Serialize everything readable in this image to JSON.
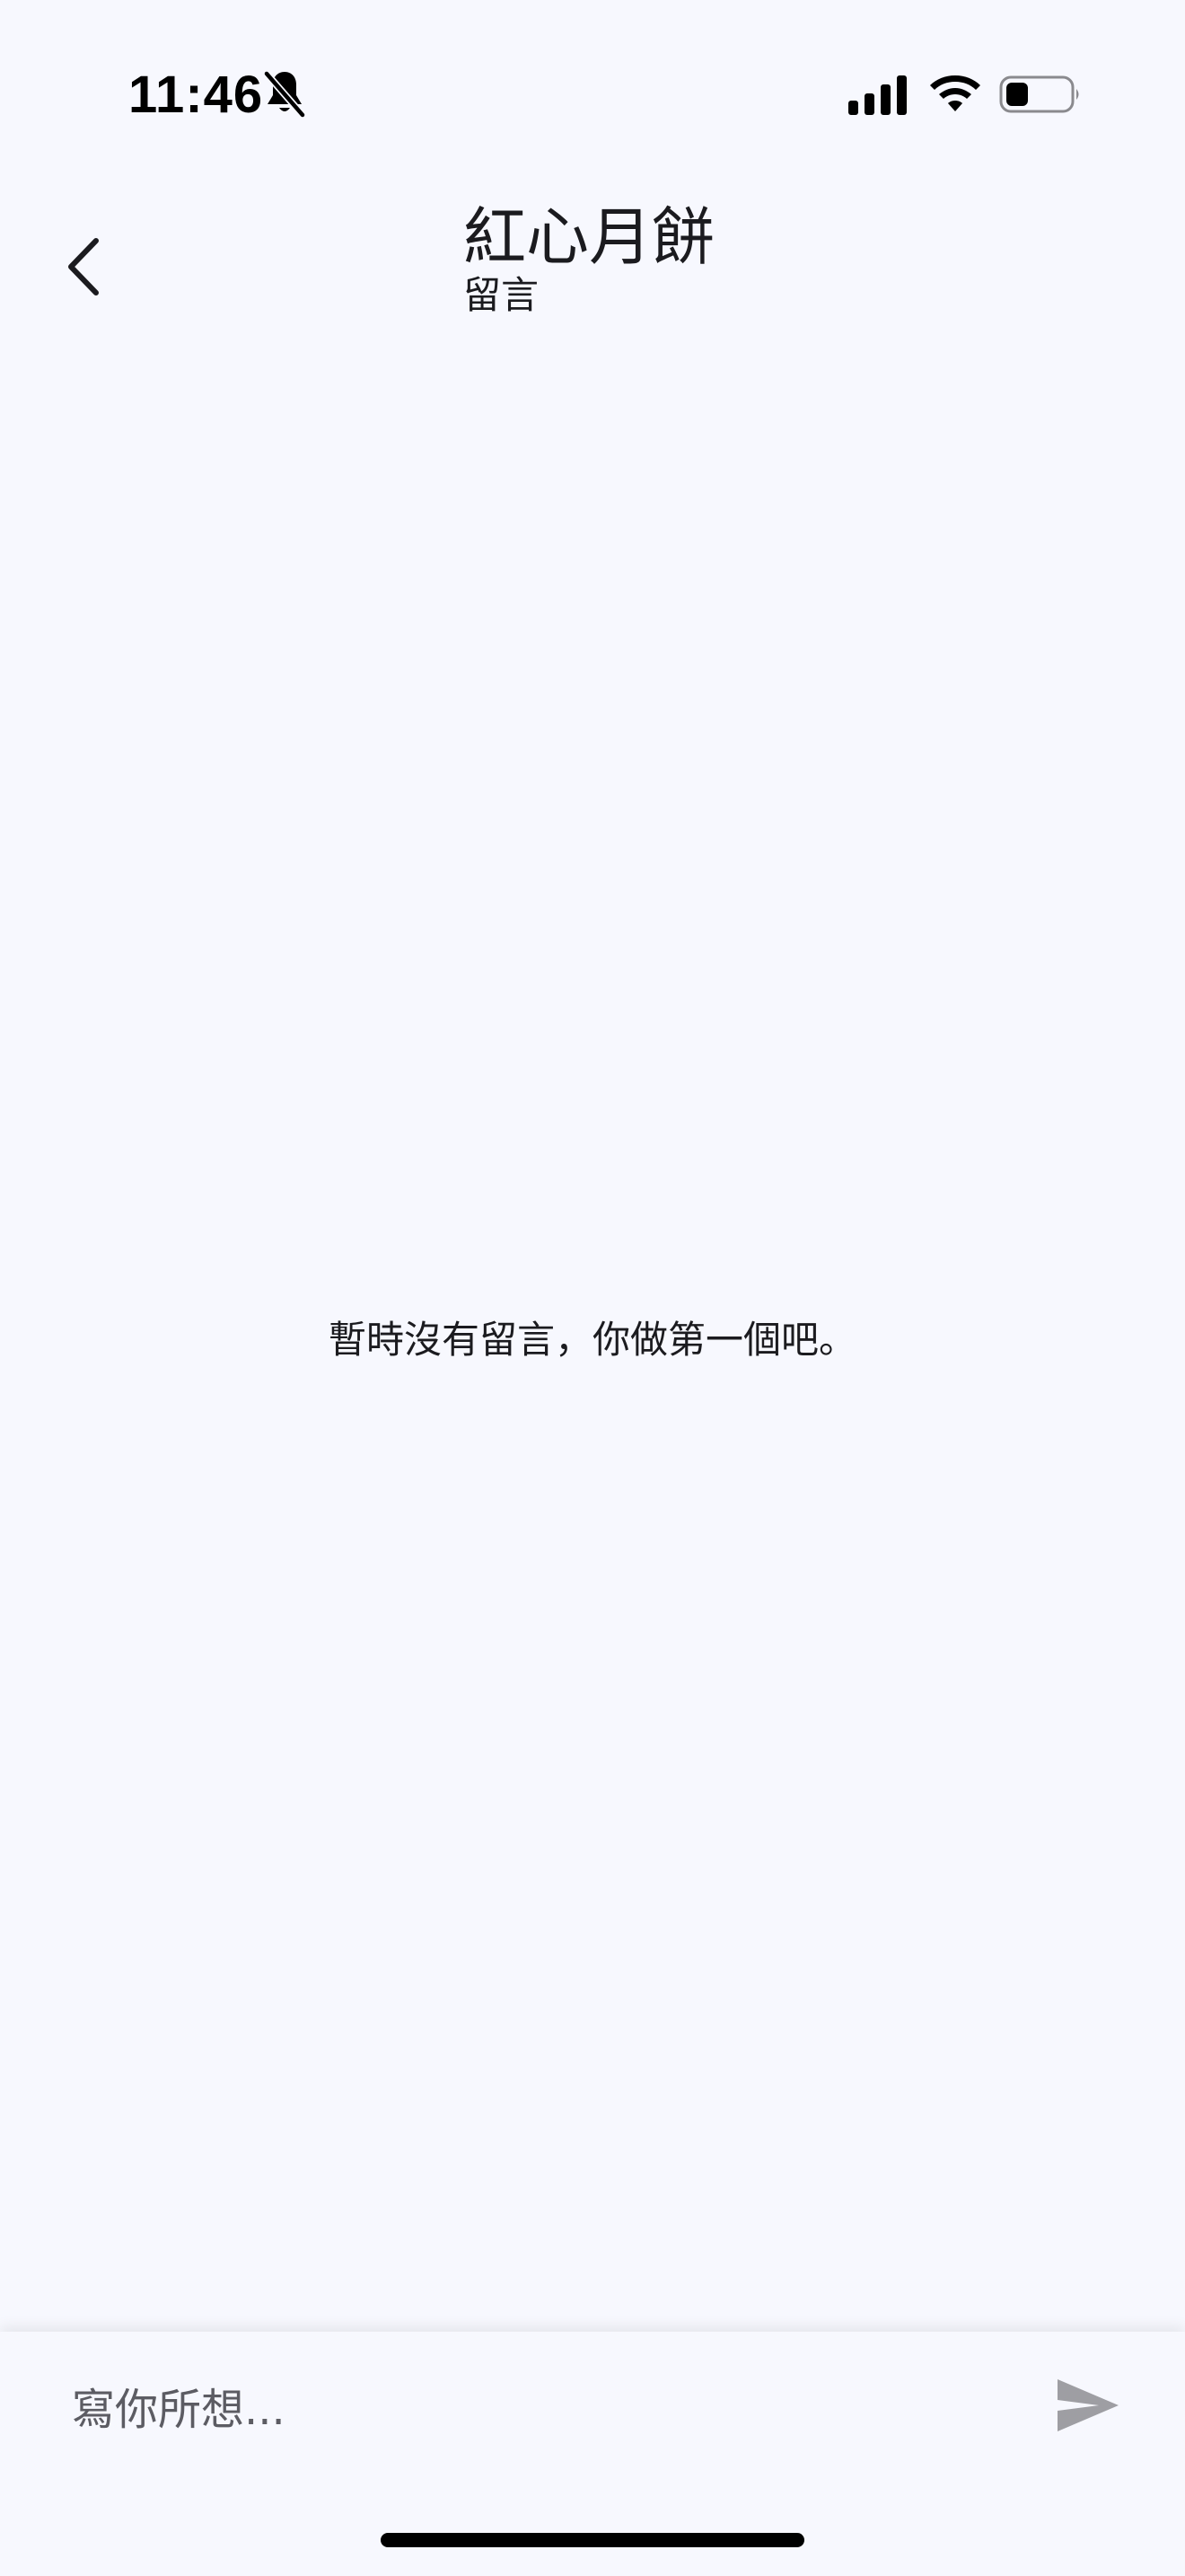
{
  "status_bar": {
    "time": "11:46",
    "icons": [
      "bell-slash-icon",
      "signal-icon",
      "wifi-icon",
      "battery-icon"
    ]
  },
  "header": {
    "back_icon": "chevron-left-icon",
    "title": "紅心月餅",
    "subtitle": "留言"
  },
  "main": {
    "empty_message": "暫時沒有留言，你做第一個吧。"
  },
  "comment_bar": {
    "input_value": "",
    "input_placeholder": "寫你所想...",
    "send_icon": "send-icon"
  },
  "colors": {
    "background": "#f7f8fe",
    "text": "#1b1b1f",
    "placeholder": "#5c5c63",
    "send_disabled": "#9e9ea3"
  }
}
